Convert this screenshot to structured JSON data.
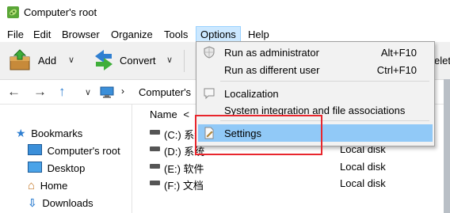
{
  "window": {
    "title": "Computer's root"
  },
  "menubar": {
    "items": [
      {
        "label": "File"
      },
      {
        "label": "Edit"
      },
      {
        "label": "Browser"
      },
      {
        "label": "Organize"
      },
      {
        "label": "Tools"
      },
      {
        "label": "Options",
        "active": true
      },
      {
        "label": "Help"
      }
    ]
  },
  "toolbar": {
    "add_label": "Add",
    "convert_label": "Convert",
    "delete_label_partial": "elet"
  },
  "addressbar": {
    "path_label": "Computer's"
  },
  "tree": {
    "items": [
      {
        "label": "Bookmarks",
        "icon": "star-icon"
      },
      {
        "label": "Computer's root",
        "icon": "computer-icon"
      },
      {
        "label": "Desktop",
        "icon": "desktop-icon"
      },
      {
        "label": "Home",
        "icon": "home-icon"
      },
      {
        "label": "Downloads",
        "icon": "download-icon"
      }
    ]
  },
  "filelist": {
    "column_name": "Name",
    "rows": [
      {
        "name": "(C:) 系统",
        "type": ""
      },
      {
        "name": "(D:) 系统",
        "type": "Local disk"
      },
      {
        "name": "(E:) 软件",
        "type": "Local disk"
      },
      {
        "name": "(F:) 文档",
        "type": "Local disk"
      }
    ]
  },
  "options_menu": {
    "items": [
      {
        "label": "Run as administrator",
        "shortcut": "Alt+F10"
      },
      {
        "label": "Run as different user",
        "shortcut": "Ctrl+F10"
      },
      {
        "label": "Localization",
        "shortcut": ""
      },
      {
        "label": "System integration and file associations",
        "shortcut": ""
      },
      {
        "label": "Settings",
        "shortcut": "",
        "highlighted": true
      }
    ]
  },
  "colors": {
    "highlight": "#91c9f7",
    "annotation": "#e8262d",
    "menu_active": "#cce8ff"
  }
}
